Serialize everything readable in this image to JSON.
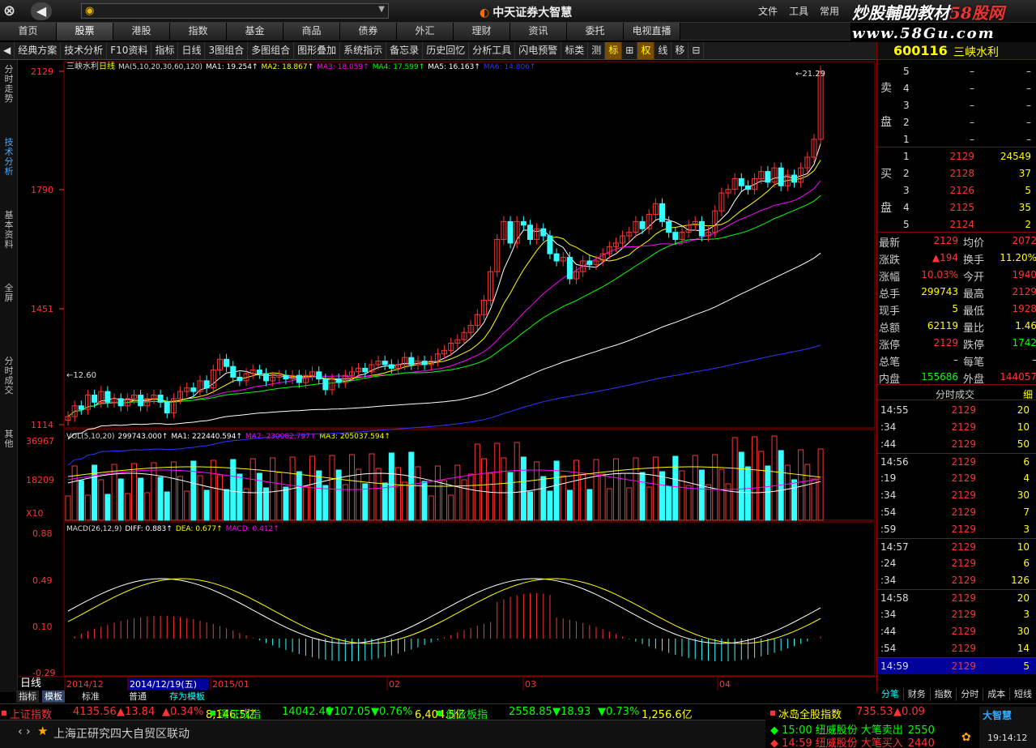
{
  "titlebar": {
    "app_title": "中天证券大智慧",
    "menus": [
      "文件",
      "工具",
      "常用"
    ]
  },
  "watermark": {
    "line1_a": "炒股輔助教材",
    "line1_b": "58股网",
    "line2": "www.58Gu.com"
  },
  "nav_tabs": [
    "首页",
    "股票",
    "港股",
    "指数",
    "基金",
    "商品",
    "债券",
    "外汇",
    "理财",
    "资讯",
    "委托",
    "电视直播"
  ],
  "nav_selected": 1,
  "toolbar": [
    "经典方案",
    "技术分析",
    "F10资料",
    "指标",
    "日线",
    "3图组合",
    "多图组合",
    "图形叠加",
    "系统指示",
    "备忘录",
    "历史回忆",
    "分析工具",
    "闪电预警",
    "标类",
    "测",
    "标",
    "⊞",
    "权",
    "线",
    "移",
    "⊟"
  ],
  "side_tabs": [
    "分时走势",
    "技术分析",
    "基本资料",
    "全屏",
    "分时成交",
    "其他"
  ],
  "chart": {
    "title": "三峡水利",
    "period": "日线",
    "ma_label": "MA(5,10,20,30,60,120)",
    "ma_values": [
      {
        "name": "MA1",
        "value": "19.254",
        "color": "#ffffff"
      },
      {
        "name": "MA2",
        "value": "18.867",
        "color": "#ffff00"
      },
      {
        "name": "MA3",
        "value": "18.059",
        "color": "#ff00ff"
      },
      {
        "name": "MA4",
        "value": "17.599",
        "color": "#00ff00"
      },
      {
        "name": "MA5",
        "value": "16.163",
        "color": "#ffffff"
      },
      {
        "name": "MA6",
        "value": "14.806",
        "color": "#3333ff"
      }
    ],
    "price_ticks": [
      "2129",
      "1790",
      "1451",
      "1114"
    ],
    "high_mark": "21.29",
    "low_mark": "12.60",
    "vol_label": "VOL(5,10,20)",
    "vol_values": [
      {
        "name": "",
        "value": "299743.000",
        "color": "#ffffff"
      },
      {
        "name": "MA1",
        "value": "222440.594",
        "color": "#ffffff"
      },
      {
        "name": "MA2",
        "value": "230082.797",
        "color": "#ff00ff"
      },
      {
        "name": "MA3",
        "value": "205037.594",
        "color": "#ffff00"
      }
    ],
    "vol_ticks": [
      "36967",
      "18209",
      "X10"
    ],
    "macd_label": "MACD(26,12,9)",
    "macd_values": [
      {
        "name": "DIFF",
        "value": "0.883",
        "color": "#ffffff"
      },
      {
        "name": "DEA",
        "value": "0.677",
        "color": "#ffff00"
      },
      {
        "name": "MACD",
        "value": "0.412",
        "color": "#ff00ff"
      }
    ],
    "macd_ticks": [
      "0.88",
      "0.49",
      "0.10",
      "-0.29"
    ],
    "dates": [
      "2014/12",
      "2014/12/19(五)",
      "2015/01",
      "02",
      "03",
      "04"
    ],
    "colors": {
      "up": "#ff3333",
      "down": "#33ffff",
      "grid": "#8b0000",
      "axis_text": "#ff3333"
    }
  },
  "bottom_tabs": {
    "period": "日线",
    "items": [
      "指标",
      "模板",
      "标准",
      "普通",
      "存为模板"
    ]
  },
  "right_panel": {
    "code": "600116",
    "name": "三峡水利",
    "sell_label": [
      "卖",
      "盘"
    ],
    "buy_label": [
      "买",
      "盘"
    ],
    "sell": [
      {
        "lvl": "5",
        "p": "–",
        "v": "–"
      },
      {
        "lvl": "4",
        "p": "–",
        "v": "–"
      },
      {
        "lvl": "3",
        "p": "–",
        "v": "–"
      },
      {
        "lvl": "2",
        "p": "–",
        "v": "–"
      },
      {
        "lvl": "1",
        "p": "–",
        "v": "–"
      }
    ],
    "buy": [
      {
        "lvl": "1",
        "p": "2129",
        "v": "24549"
      },
      {
        "lvl": "2",
        "p": "2128",
        "v": "37"
      },
      {
        "lvl": "3",
        "p": "2126",
        "v": "5"
      },
      {
        "lvl": "4",
        "p": "2125",
        "v": "35"
      },
      {
        "lvl": "5",
        "p": "2124",
        "v": "2"
      }
    ],
    "quotes": [
      {
        "l": "最新",
        "lv": "2129",
        "lc": "#f33",
        "r": "均价",
        "rv": "2072",
        "rc": "#f33"
      },
      {
        "l": "涨跌",
        "lv": "▲194",
        "lc": "#f33",
        "r": "换手",
        "rv": "11.20%",
        "rc": "#ff0"
      },
      {
        "l": "涨幅",
        "lv": "10.03%",
        "lc": "#f33",
        "r": "今开",
        "rv": "1940",
        "rc": "#f33"
      },
      {
        "l": "总手",
        "lv": "299743",
        "lc": "#ff0",
        "r": "最高",
        "rv": "2129",
        "rc": "#f33"
      },
      {
        "l": "现手",
        "lv": "5",
        "lc": "#ff0",
        "r": "最低",
        "rv": "1928",
        "rc": "#f33"
      },
      {
        "l": "总额",
        "lv": "62119",
        "lc": "#ff0",
        "r": "量比",
        "rv": "1.46",
        "rc": "#ff0"
      },
      {
        "l": "涨停",
        "lv": "2129",
        "lc": "#f33",
        "r": "跌停",
        "rv": "1742",
        "rc": "#0f0"
      },
      {
        "l": "总笔",
        "lv": "–",
        "lc": "#ddd",
        "r": "每笔",
        "rv": "–",
        "rc": "#ddd"
      },
      {
        "l": "内盘",
        "lv": "155686",
        "lc": "#0f0",
        "r": "外盘",
        "rv": "144057",
        "rc": "#f33"
      }
    ],
    "ticks_title": "分时成交",
    "ticks_btn": "细",
    "ticks": [
      {
        "t": "14:55",
        "p": "2129",
        "v": "20"
      },
      {
        "t": ":34",
        "p": "2129",
        "v": "10"
      },
      {
        "t": ":44",
        "p": "2129",
        "v": "50"
      },
      {
        "t": "14:56",
        "p": "2129",
        "v": "6"
      },
      {
        "t": ":19",
        "p": "2129",
        "v": "4"
      },
      {
        "t": ":34",
        "p": "2129",
        "v": "30"
      },
      {
        "t": ":54",
        "p": "2129",
        "v": "7"
      },
      {
        "t": ":59",
        "p": "2129",
        "v": "3"
      },
      {
        "t": "14:57",
        "p": "2129",
        "v": "10"
      },
      {
        "t": ":24",
        "p": "2129",
        "v": "6"
      },
      {
        "t": ":34",
        "p": "2129",
        "v": "126"
      },
      {
        "t": "14:58",
        "p": "2129",
        "v": "20"
      },
      {
        "t": ":34",
        "p": "2129",
        "v": "3"
      },
      {
        "t": ":44",
        "p": "2129",
        "v": "30"
      },
      {
        "t": ":54",
        "p": "2129",
        "v": "14"
      },
      {
        "t": "14:59",
        "p": "2129",
        "v": "5"
      }
    ],
    "tabs": [
      "分笔",
      "财务",
      "指数",
      "分时",
      "成本",
      "短线"
    ]
  },
  "ticker": [
    {
      "name": "上证指数",
      "val": "4135.56",
      "chg": "▲13.84",
      "pct": "▲0.34%",
      "amt": "8,146.5亿"
    },
    {
      "name": "深证成指",
      "val": "14042.46",
      "chg": "▼107.05",
      "pct": "▼0.76%",
      "amt": "6,404.5亿"
    },
    {
      "name": "创业板指",
      "val": "2558.85",
      "chg": "▼18.93",
      "pct": "▼0.73%",
      "amt": "1,256.6亿"
    },
    {
      "name": "冰岛全股指数",
      "val": "735.53",
      "chg": "▲0.09",
      "pct": "",
      "amt": ""
    }
  ],
  "news": "上海正研究四大自贸区联动",
  "alerts": [
    {
      "time": "15:00",
      "text": "纽威股份 大笔卖出",
      "val": "2550",
      "color": "#0f0"
    },
    {
      "time": "14:59",
      "text": "纽威股份 大笔买入",
      "val": "2440",
      "color": "#f33"
    }
  ],
  "brand": "大智慧",
  "clock": "19:14:12"
}
